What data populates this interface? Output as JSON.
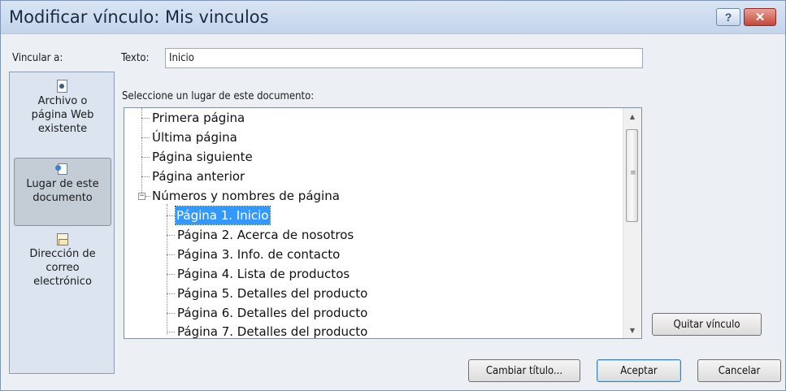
{
  "window": {
    "title": "Modificar vínculo: Mis vinculos",
    "help_label": "?",
    "close_label": "✕"
  },
  "link_to": {
    "label": "Vincular a:",
    "items": [
      {
        "label_lines": [
          "Archivo o",
          "página Web",
          "existente"
        ],
        "icon": "web-page-icon"
      },
      {
        "label_lines": [
          "Lugar de este",
          "documento"
        ],
        "icon": "place-in-document-icon",
        "selected": true
      },
      {
        "label_lines": [
          "Dirección de",
          "correo",
          "electrónico"
        ],
        "icon": "email-address-icon"
      }
    ]
  },
  "text_field": {
    "label": "Texto:",
    "value": "Inicio"
  },
  "place_list": {
    "label": "Seleccione un lugar de este documento:",
    "items": [
      {
        "text": "Primera página"
      },
      {
        "text": "Última página"
      },
      {
        "text": "Página siguiente"
      },
      {
        "text": "Página anterior"
      },
      {
        "text": "Números y nombres de página",
        "expanded": true
      },
      {
        "text": "Página 1. Inicio",
        "selected": true
      },
      {
        "text": "Página 2. Acerca de nosotros"
      },
      {
        "text": "Página 3. Info. de contacto"
      },
      {
        "text": "Página 4. Lista de productos"
      },
      {
        "text": "Página 5. Detalles del producto"
      },
      {
        "text": "Página 6. Detalles del producto"
      },
      {
        "text": "Página 7. Detalles del producto"
      }
    ],
    "expander_symbol": "−"
  },
  "buttons": {
    "remove_link": "Quitar vínculo",
    "change_title": "Cambiar título...",
    "ok": "Aceptar",
    "cancel": "Cancelar"
  },
  "colors": {
    "selection": "#3399ff",
    "close_button": "#c4483a",
    "dialog_background": "#ecf0f5"
  }
}
